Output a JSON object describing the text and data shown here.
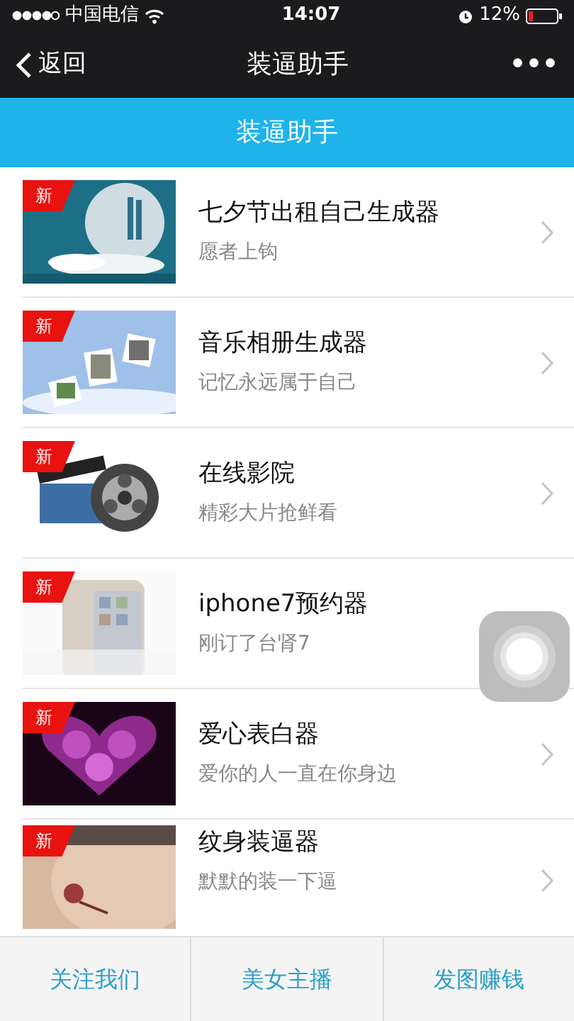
{
  "status_bar": {
    "carrier": "中国电信",
    "time": "14:07",
    "battery": "12%"
  },
  "nav_bar": {
    "back": "返回",
    "title": "装逼助手",
    "more": "•••"
  },
  "header": {
    "title": "装逼助手"
  },
  "items": [
    {
      "title": "七夕节出租自己生成器",
      "subtitle": "愿者上钩",
      "badge": "新"
    },
    {
      "title": "音乐相册生成器",
      "subtitle": "记忆永远属于自己",
      "badge": "新"
    },
    {
      "title": "在线影院",
      "subtitle": "精彩大片抢鲜看",
      "badge": "新"
    },
    {
      "title": "iphone7预约器",
      "subtitle": "刚订了台肾7",
      "badge": "新"
    },
    {
      "title": "爱心表白器",
      "subtitle": "爱你的人一直在你身边",
      "badge": "新"
    },
    {
      "title": "纹身装逼器",
      "subtitle": "默默的装一下逼",
      "badge": "新"
    }
  ],
  "assistive_touch": true,
  "tab_bar": [
    "关注我们",
    "美女主播",
    "发图赚钱"
  ]
}
